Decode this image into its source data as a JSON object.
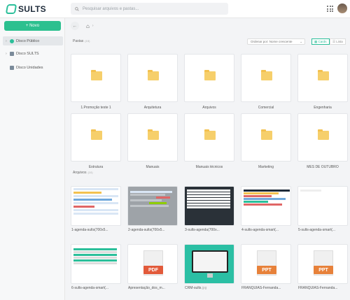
{
  "app": {
    "name": "SULTS"
  },
  "colors": {
    "brand": "#2bbf9a",
    "new_button": "#2cc08f"
  },
  "search": {
    "placeholder": "Pesquisar arquivos e pastas..."
  },
  "sidebar": {
    "new_label": "+ Novo",
    "items": [
      {
        "label": "Disco Público",
        "icon": "globe-icon",
        "active": true
      },
      {
        "label": "Disco SULTS",
        "icon": "building-icon"
      },
      {
        "label": "Disco Unidades",
        "icon": "store-icon"
      }
    ]
  },
  "folders_section": {
    "title": "Pastas",
    "count": "(15)"
  },
  "sort": {
    "label": "Ordenar por: Nome crescente"
  },
  "views": {
    "cards": "Cards",
    "list": "Lista"
  },
  "folders": [
    "1.Promoção teste 1",
    "Arquitetura",
    "Arquivos",
    "Comercial",
    "Engenharia",
    "Estrutura",
    "Manuais",
    "Manuais técnicos",
    "Marketing",
    "MÊS DE OUTUBRO"
  ],
  "files_section": {
    "title": "Arquivos",
    "count": "(10)"
  },
  "files": [
    {
      "name": "1-agenda-sults(700x5...",
      "ext": "",
      "kind": "spreadsheet"
    },
    {
      "name": "2-agenda-sults(700x5...",
      "ext": "",
      "kind": "gantt"
    },
    {
      "name": "3-sults-agenda(700x...",
      "ext": "",
      "kind": "list"
    },
    {
      "name": "4-sults-agenda-smart(...",
      "ext": "",
      "kind": "grid"
    },
    {
      "name": "5-sults-agenda-smart(...",
      "ext": "",
      "kind": "blank"
    },
    {
      "name": "6-sults-agenda-smart(...",
      "ext": "",
      "kind": "checklist"
    },
    {
      "name": "Apresentação_dos_m...",
      "ext": "",
      "kind": "pdf",
      "badge": "PDF"
    },
    {
      "name": "CRM-sults",
      "ext": ".jpg",
      "kind": "monitor"
    },
    {
      "name": "FRANQUIAS-Fernanda...",
      "ext": "",
      "kind": "ppt",
      "badge": "PPT"
    },
    {
      "name": "FRANQUIAS-Fernanda...",
      "ext": "",
      "kind": "ppt",
      "badge": "PPT"
    }
  ]
}
